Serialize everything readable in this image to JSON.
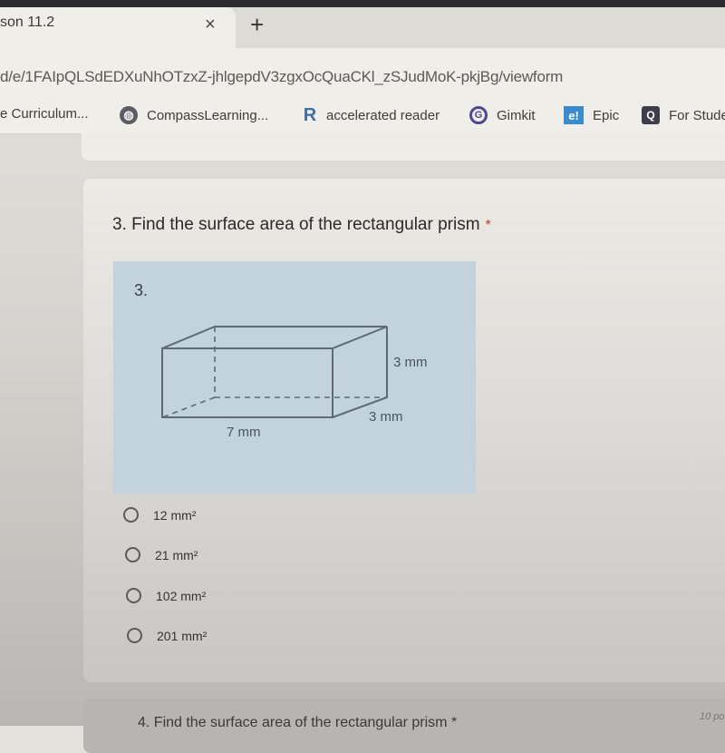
{
  "browser": {
    "tab_title": "son 11.2",
    "tab_close": "×",
    "new_tab": "+",
    "url": "d/e/1FAIpQLSdEDXuNhOTzxZ-jhlgepdV3zgxOcQuaCKl_zSJudMoK-pkjBg/viewform",
    "bookmarks": [
      {
        "label": "e Curriculum...",
        "icon": "none"
      },
      {
        "label": "CompassLearning...",
        "icon": "globe-icon"
      },
      {
        "label": "accelerated reader",
        "icon": "r-logo-icon",
        "glyph": "R"
      },
      {
        "label": "Gimkit",
        "icon": "gimkit-icon",
        "glyph": "G"
      },
      {
        "label": "Epic",
        "icon": "epic-icon",
        "glyph": "e!"
      },
      {
        "label": "For Stude",
        "icon": "q-icon",
        "glyph": "Q"
      }
    ]
  },
  "question": {
    "number_title": "3. Find the surface area of the rectangular prism",
    "required_mark": "*",
    "figure": {
      "label": "3.",
      "height_label": "3 mm",
      "depth_label": "3 mm",
      "length_label": "7 mm",
      "background_color": "#c2d3de"
    },
    "options": [
      "12 mm²",
      "21 mm²",
      "102 mm²",
      "201 mm²"
    ]
  },
  "next_question": {
    "title": "4. Find the surface area of the rectangular prism *",
    "points": "10 po"
  },
  "colors": {
    "required": "#d93025"
  }
}
